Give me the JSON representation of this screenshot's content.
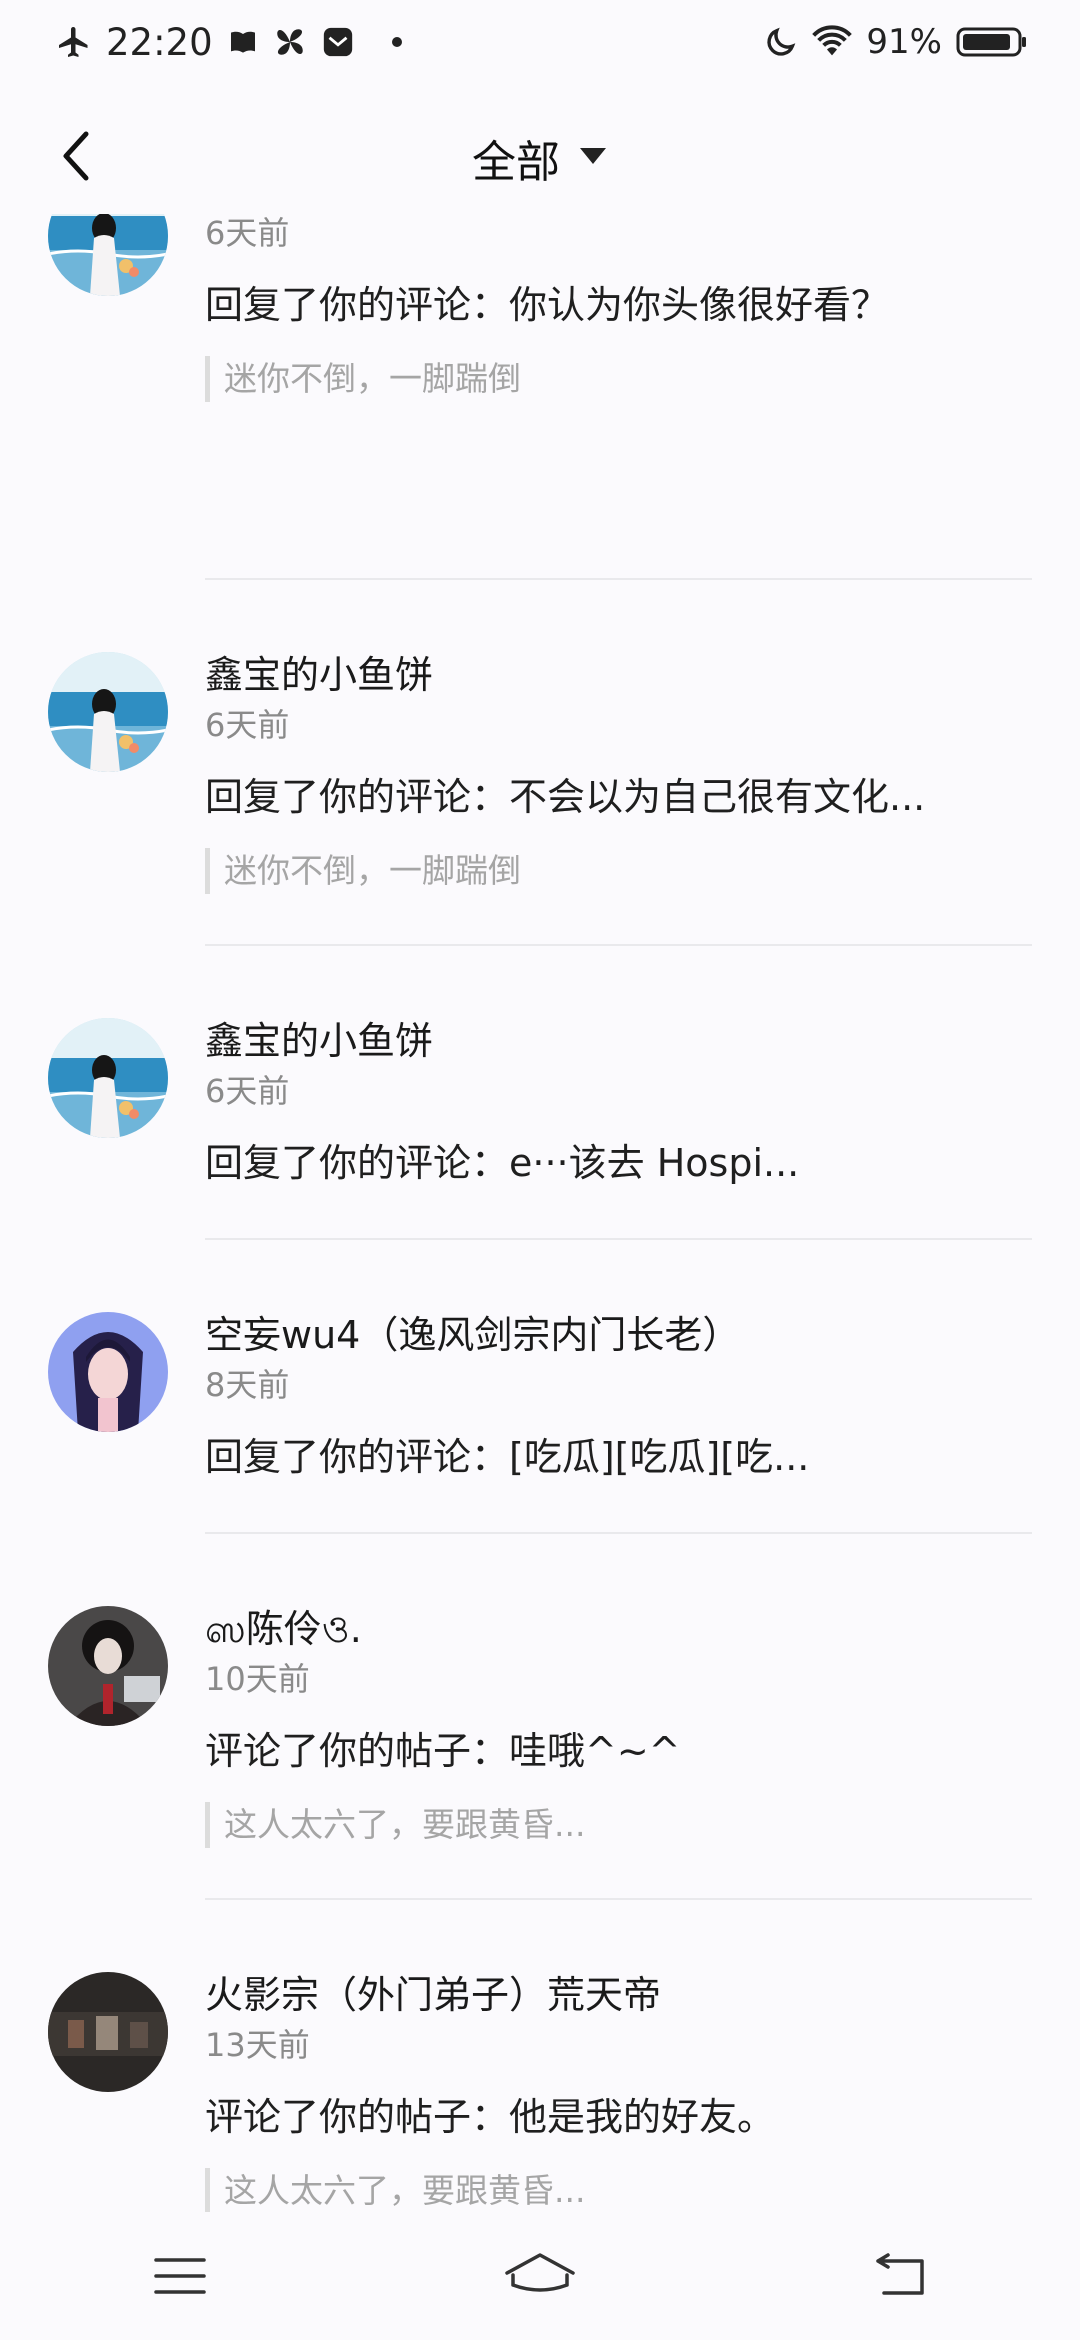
{
  "status_bar": {
    "time": "22:20",
    "battery_percent": "91%",
    "battery_level": 0.91,
    "icons_left": [
      "airplane-icon",
      "book-icon",
      "pinwheel-icon",
      "mail-app-icon",
      "dot-icon"
    ],
    "icons_right": [
      "moon-icon",
      "wifi-icon",
      "battery-icon"
    ]
  },
  "header": {
    "filter_label": "全部",
    "icons": [
      "back-arrow-icon",
      "dropdown-triangle-icon"
    ]
  },
  "notifications": [
    {
      "username": "",
      "time": "6天前",
      "message": "回复了你的评论：你认为你头像很好看？",
      "quote": "迷你不倒，一脚踹倒",
      "avatar": "sea-girl"
    },
    {
      "username": "鑫宝的小鱼饼",
      "time": "6天前",
      "message": "回复了你的评论：不会以为自己很有文化...",
      "quote": "迷你不倒，一脚踹倒",
      "avatar": "sea-girl"
    },
    {
      "username": "鑫宝的小鱼饼",
      "time": "6天前",
      "message": "回复了你的评论：e···该去 Hospi...",
      "quote": "",
      "avatar": "sea-girl"
    },
    {
      "username": "空妄wu4（逸风剑宗内门长老）",
      "time": "8天前",
      "message": "回复了你的评论：[吃瓜][吃瓜][吃...",
      "quote": "",
      "avatar": "anime-purple"
    },
    {
      "username": "ஸ陈伶ও.",
      "time": "10天前",
      "message": "评论了你的帖子：哇哦^~^",
      "quote": "这人太六了，要跟黄昏...",
      "avatar": "anime-dark"
    },
    {
      "username": "火影宗（外门弟子）荒天帝",
      "time": "13天前",
      "message": "评论了你的帖子：他是我的好友。",
      "quote": "这人太六了，要跟黄昏...",
      "avatar": "game-dark"
    }
  ],
  "bottom_nav": {
    "icons": [
      "menu-icon",
      "home-icon",
      "back-icon"
    ]
  },
  "colors": {
    "background": "#fbfafd",
    "text": "#1a1a1a",
    "secondary": "#8a8a8a",
    "quote": "#a5a5a5"
  }
}
